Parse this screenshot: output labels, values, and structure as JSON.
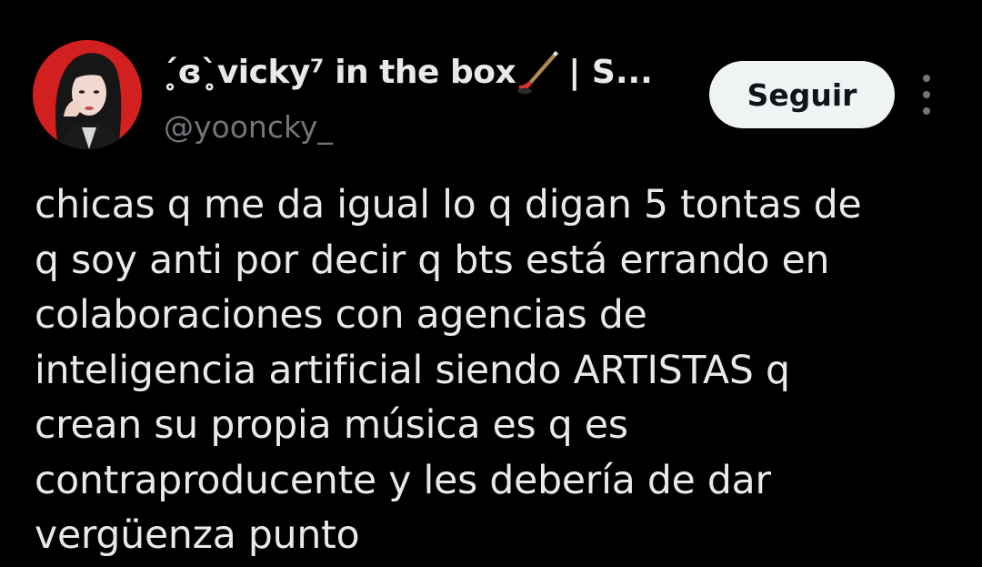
{
  "author": {
    "display_name": "ˊ̥ɞˋ̥vicky⁷ in the box",
    "name_suffix": "| S...",
    "handle": "@yooncky_",
    "avatar_icon": "profile-photo-avatar",
    "name_icon": "hockey-stick-emoji"
  },
  "actions": {
    "follow_label": "Seguir",
    "more_icon": "more-vertical-icon"
  },
  "tweet": {
    "lines": [
      "chicas q me da igual lo q digan 5 tontas de",
      "q soy anti por decir q bts está errando en",
      "colaboraciones con agencias de",
      "inteligencia artificial siendo ARTISTAS q",
      "crean su propia música es q es",
      "contraproducente y les debería de dar",
      "vergüenza punto"
    ]
  },
  "colors": {
    "background": "#000000",
    "text_primary": "#e7e9ea",
    "text_secondary": "#71767b",
    "follow_bg": "#eff3f4",
    "avatar_bg": "#d21f1f"
  }
}
